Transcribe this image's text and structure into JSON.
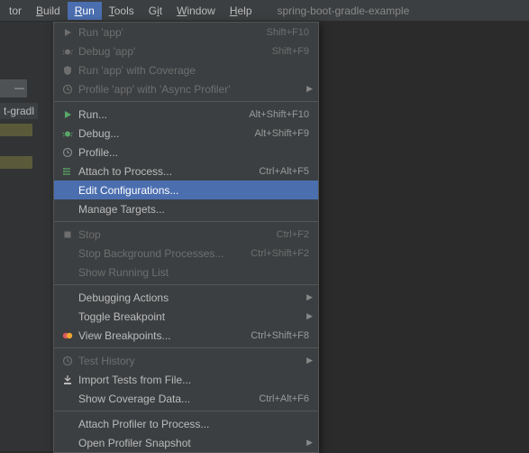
{
  "menubar": {
    "items": [
      {
        "label": "tor",
        "underline": -1
      },
      {
        "label": "Build",
        "underline": 0
      },
      {
        "label": "Run",
        "underline": 0,
        "active": true
      },
      {
        "label": "Tools",
        "underline": 0
      },
      {
        "label": "Git",
        "underline": 1
      },
      {
        "label": "Window",
        "underline": 0
      },
      {
        "label": "Help",
        "underline": 0
      }
    ],
    "project": "spring-boot-gradle-example"
  },
  "sidebar": {
    "tab_close": "—",
    "file_fragment": "t-gradl"
  },
  "dropdown": {
    "groups": [
      [
        {
          "icon": "play",
          "label": "Run 'app'",
          "shortcut": "Shift+F10",
          "disabled": true
        },
        {
          "icon": "bug",
          "label": "Debug 'app'",
          "shortcut": "Shift+F9",
          "disabled": true
        },
        {
          "icon": "shield",
          "label": "Run 'app' with Coverage",
          "shortcut": "",
          "disabled": true
        },
        {
          "icon": "clock",
          "label": "Profile 'app' with 'Async Profiler'",
          "shortcut": "",
          "disabled": true,
          "submenu": true
        }
      ],
      [
        {
          "icon": "play-green",
          "label": "Run...",
          "shortcut": "Alt+Shift+F10"
        },
        {
          "icon": "bug-green",
          "label": "Debug...",
          "shortcut": "Alt+Shift+F9"
        },
        {
          "icon": "clock-green",
          "label": "Profile...",
          "shortcut": ""
        },
        {
          "icon": "attach",
          "label": "Attach to Process...",
          "shortcut": "Ctrl+Alt+F5"
        },
        {
          "icon": "",
          "label": "Edit Configurations...",
          "shortcut": "",
          "highlight": true
        },
        {
          "icon": "",
          "label": "Manage Targets...",
          "shortcut": ""
        }
      ],
      [
        {
          "icon": "stop",
          "label": "Stop",
          "shortcut": "Ctrl+F2",
          "disabled": true
        },
        {
          "icon": "",
          "label": "Stop Background Processes...",
          "shortcut": "Ctrl+Shift+F2",
          "disabled": true
        },
        {
          "icon": "",
          "label": "Show Running List",
          "shortcut": "",
          "disabled": true
        }
      ],
      [
        {
          "icon": "",
          "label": "Debugging Actions",
          "shortcut": "",
          "submenu": true
        },
        {
          "icon": "",
          "label": "Toggle Breakpoint",
          "shortcut": "",
          "submenu": true
        },
        {
          "icon": "breakpoint",
          "label": "View Breakpoints...",
          "shortcut": "Ctrl+Shift+F8"
        }
      ],
      [
        {
          "icon": "clock",
          "label": "Test History",
          "shortcut": "",
          "disabled": true,
          "submenu": true
        },
        {
          "icon": "import",
          "label": "Import Tests from File...",
          "shortcut": ""
        },
        {
          "icon": "",
          "label": "Show Coverage Data...",
          "shortcut": "Ctrl+Alt+F6"
        }
      ],
      [
        {
          "icon": "",
          "label": "Attach Profiler to Process...",
          "shortcut": ""
        },
        {
          "icon": "",
          "label": "Open Profiler Snapshot",
          "shortcut": "",
          "submenu": true
        }
      ]
    ]
  }
}
